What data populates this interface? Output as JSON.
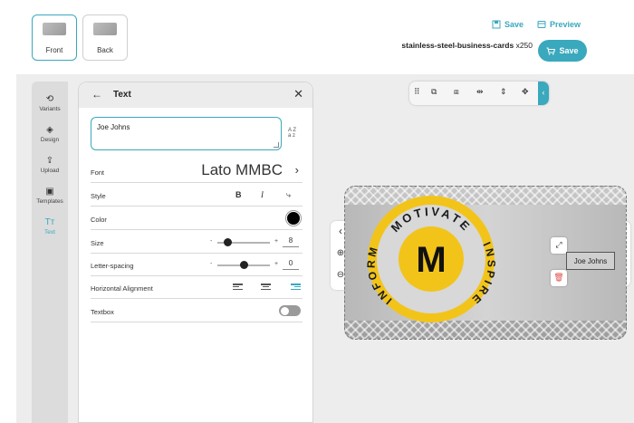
{
  "sides": [
    {
      "label": "Front",
      "active": true
    },
    {
      "label": "Back",
      "active": false
    }
  ],
  "header": {
    "save_link": "Save",
    "preview_link": "Preview",
    "product_name": "stainless-steel-business-cards",
    "quantity": "x250",
    "save_button": "Save"
  },
  "sidebar": {
    "items": [
      {
        "label": "Variants",
        "icon": "variants-icon"
      },
      {
        "label": "Design",
        "icon": "design-icon"
      },
      {
        "label": "Upload",
        "icon": "upload-icon"
      },
      {
        "label": "Templates",
        "icon": "templates-icon"
      },
      {
        "label": "Text",
        "icon": "text-icon",
        "active": true
      }
    ]
  },
  "panel": {
    "title": "Text",
    "text_value": "Joe Johns",
    "font_label": "Font",
    "font_value": "Lato MMBC",
    "style_label": "Style",
    "style_bold": "B",
    "style_italic": "I",
    "color_label": "Color",
    "color_value": "#000000",
    "size_label": "Size",
    "size_value": "8",
    "size_level": 0.2,
    "letter_spacing_label": "Letter-spacing",
    "letter_spacing_value": "0",
    "letter_spacing_level": 0.5,
    "horizontal_alignment_label": "Horizontal Alignment",
    "alignment_selected": "right",
    "textbox_label": "Textbox",
    "textbox_on": false,
    "minus": "-",
    "plus": "+"
  },
  "card": {
    "emblem_top_text": "MOTIVATE",
    "emblem_right_text": "INSPIRE",
    "emblem_left_text": "INFORM",
    "emblem_letter": "M",
    "text_box": "Joe Johns"
  },
  "colors": {
    "accent": "#3aa8bd",
    "emblem_yellow": "#f2c41a",
    "delete_red": "#e04d4d"
  }
}
